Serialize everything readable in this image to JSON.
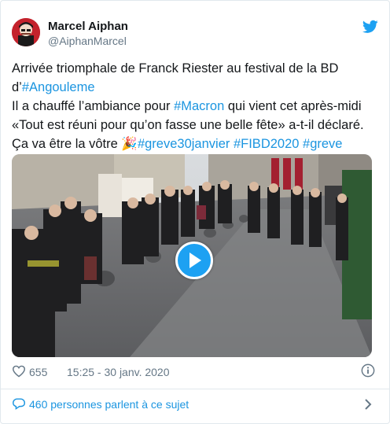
{
  "author": {
    "display_name": "Marcel Aiphan",
    "handle": "@AiphanMarcel"
  },
  "tweet": {
    "line1": "Arrivée triomphale de Franck Riester au festival de la BD",
    "line2_prefix": "d’",
    "line2_tag": "#Angouleme",
    "line3_prefix": "Il a chauffé l’ambiance pour ",
    "line3_tag": "#Macron",
    "line3_suffix": " qui vient cet après-midi",
    "line4": "«Tout est réuni pour qu’on fasse une belle fête» a-t-il déclaré.",
    "line5_prefix": "Ça va être la vôtre ",
    "line5_emoji": "🎉",
    "line5_tag1": "#greve30janvier",
    "line5_tag2": "#FIBD2020",
    "line5_tag3": "#greve"
  },
  "meta": {
    "likes": "655",
    "timestamp": "15:25 - 30 janv. 2020"
  },
  "footer": {
    "conversation": "460 personnes parlent à ce sujet"
  },
  "icons": {
    "twitter": "twitter-bird-icon",
    "play": "play-icon",
    "like": "heart-icon",
    "info": "info-icon",
    "conversation": "speech-bubble-icon",
    "chevron": "chevron-right-icon"
  },
  "colors": {
    "link": "#1b95e0",
    "brand": "#1da1f2",
    "muted": "#657786",
    "text": "#14171a"
  }
}
